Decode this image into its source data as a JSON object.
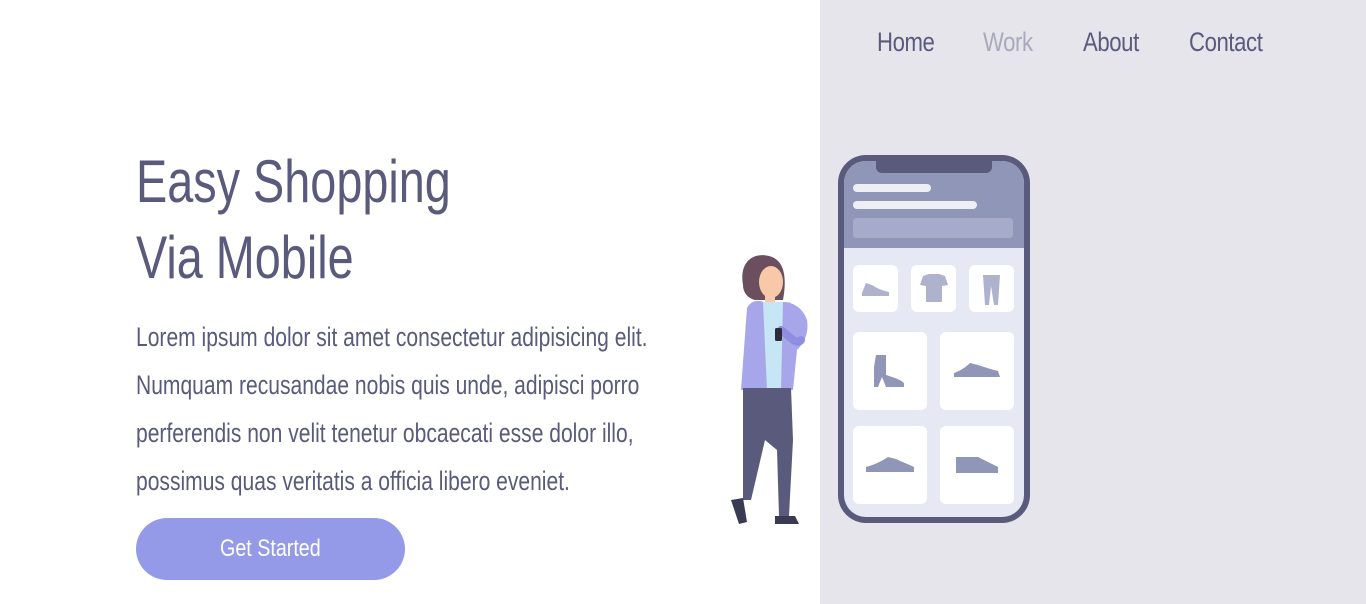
{
  "nav": {
    "items": [
      {
        "label": "Home",
        "active": false
      },
      {
        "label": "Work",
        "active": true
      },
      {
        "label": "About",
        "active": false
      },
      {
        "label": "Contact",
        "active": false
      }
    ]
  },
  "hero": {
    "title_line1": "Easy Shopping",
    "title_line2": "Via Mobile",
    "description_lines": [
      "Lorem ipsum dolor sit amet consectetur adipisicing elit.",
      "Numquam recusandae nobis quis unde, adipisci porro",
      "perferendis non velit tenetur obcaecati esse dolor illo,",
      "possimus quas veritatis a officia libero eveniet."
    ],
    "cta_label": "Get Started"
  },
  "colors": {
    "text": "#5a5a7d",
    "nav_active": "#a9a9bd",
    "accent": "#959ae8",
    "panel_bg": "#e6e5eb"
  },
  "illustration": {
    "icons": [
      "shoe-icon",
      "tshirt-icon",
      "pants-icon",
      "boot-icon",
      "sneaker-icon",
      "sneaker-icon",
      "sneaker-icon"
    ]
  }
}
